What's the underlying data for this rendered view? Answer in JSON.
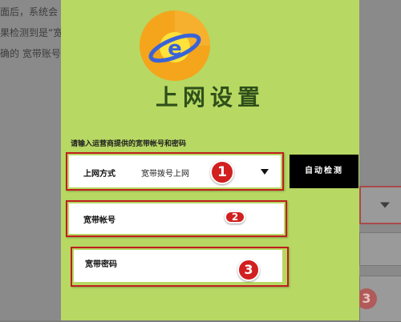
{
  "background": {
    "lines": [
      "面后，系统会",
      "果检测到是“宽",
      "确的 宽带账号"
    ]
  },
  "dialog": {
    "title": "上网设置",
    "hint": "请输入运营商提供的宽带帐号和密码",
    "connection": {
      "label": "上网方式",
      "value": "宽带拨号上网",
      "badge": "1"
    },
    "auto_detect_label": "自动检测",
    "account": {
      "label": "宽带帐号",
      "value": "",
      "badge": "2"
    },
    "password": {
      "label": "宽带密码",
      "value": "",
      "badge": "3"
    }
  },
  "colors": {
    "panel": "#b7d863",
    "highlight": "#c01e1e",
    "badge": "#d21f1f",
    "logo_orange": "#f4a51c",
    "logo_ring": "#3a63d8"
  },
  "icons": {
    "logo": "ie-globe-icon",
    "dropdown": "caret-down-icon"
  }
}
